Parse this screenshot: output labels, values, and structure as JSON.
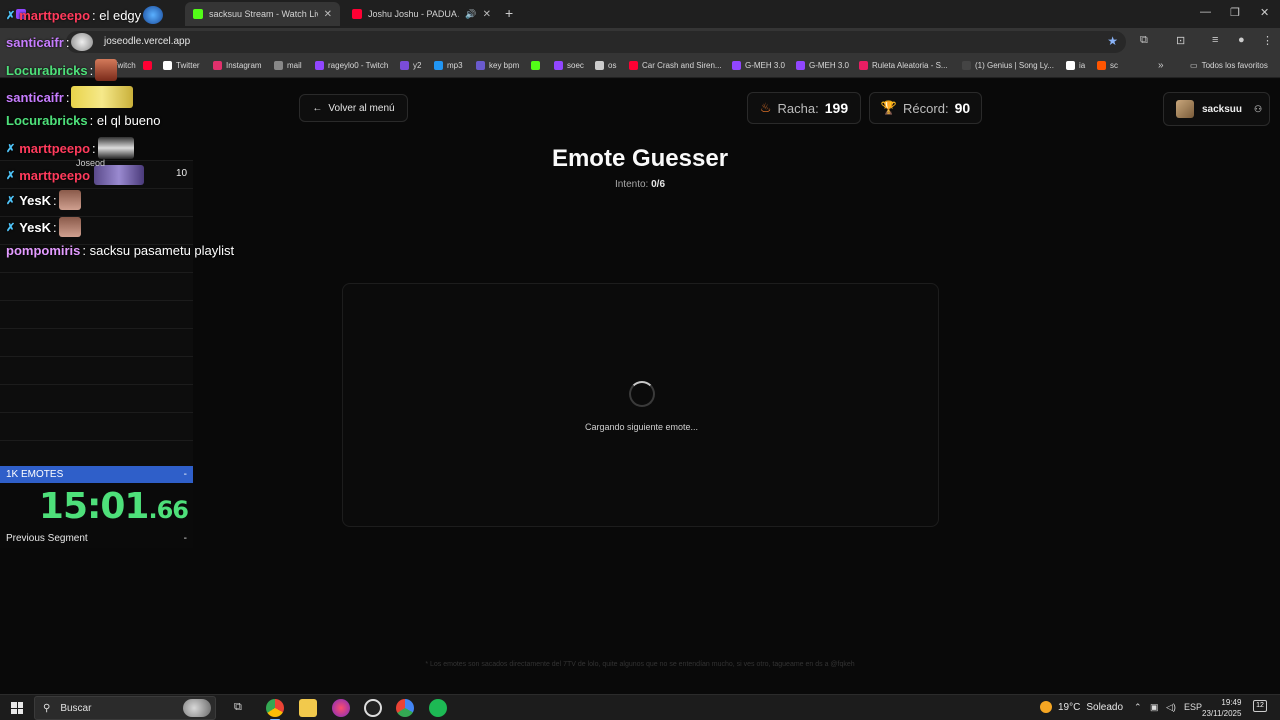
{
  "browser": {
    "tabs": [
      {
        "title": "",
        "color": "#9146ff"
      },
      {
        "title": "sacksuu Stream - Watch Live on",
        "color": "#53fc18"
      },
      {
        "title": "Joshu Joshu - PADUA ANGEL",
        "color": "#ff0033"
      }
    ],
    "new_tab": "+",
    "window_controls": {
      "minimize": "—",
      "maximize": "❐",
      "close": "✕"
    },
    "url": "joseodle.vercel.app",
    "bookmarks": [
      {
        "label": "Twitch",
        "color": "#9146ff"
      },
      {
        "label": "",
        "color": "#ff0033"
      },
      {
        "label": "Twitter",
        "color": "#ffffff"
      },
      {
        "label": "Instagram",
        "color": "#e1306c"
      },
      {
        "label": "mail",
        "color": "#888888"
      },
      {
        "label": "rageylo0 - Twitch",
        "color": "#9146ff"
      },
      {
        "label": "y2",
        "color": "#7a4cd9"
      },
      {
        "label": "mp3",
        "color": "#2196f3"
      },
      {
        "label": "key bpm",
        "color": "#6a5acd"
      },
      {
        "label": "",
        "color": "#53fc18"
      },
      {
        "label": "soec",
        "color": "#9146ff"
      },
      {
        "label": "os",
        "color": "#cccccc"
      },
      {
        "label": "Car Crash and Siren...",
        "color": "#ff0033"
      },
      {
        "label": "G-MEH 3.0",
        "color": "#9146ff"
      },
      {
        "label": "G-MEH 3.0",
        "color": "#9146ff"
      },
      {
        "label": "Ruleta Aleatoria - S...",
        "color": "#e91e63"
      },
      {
        "label": "(1) Genius | Song Ly...",
        "color": "#ffff64"
      },
      {
        "label": "ia",
        "color": "#ffffff"
      },
      {
        "label": "sc",
        "color": "#ff5500"
      }
    ],
    "all_bookmarks": "Todos los favoritos"
  },
  "page": {
    "back_button": "Volver al menú",
    "streak": {
      "label": "Racha:",
      "value": "199"
    },
    "record": {
      "label": "Récord:",
      "value": "90"
    },
    "username": "sacksuu",
    "title": "Emote Guesser",
    "attempt_label": "Intento:",
    "attempt_value": "0/6",
    "loading_text": "Cargando siguiente emote...",
    "footnote": "* Los emotes son sacados directamente del 7TV de lolo, quite algunos que no se entendían mucho, si ves otro, tagueame en ds a @fqkeh"
  },
  "chat": {
    "messages": [
      {
        "user": "marttpeepo",
        "text": ": el edgy",
        "color": "#ff3b5c",
        "badge": true
      },
      {
        "user": "santicaifr",
        "text": ":",
        "color": "#c77dff",
        "badge": false
      },
      {
        "user": "Locurabricks",
        "text": ":",
        "color": "#4ee07a",
        "badge": false
      },
      {
        "user": "santicaifr",
        "text": ":",
        "color": "#c77dff",
        "badge": false
      },
      {
        "user": "Locurabricks",
        "text": ": el ql bueno",
        "color": "#4ee07a",
        "badge": false
      },
      {
        "user": "marttpeepo",
        "text": ":",
        "color": "#ff3b5c",
        "badge": true
      },
      {
        "user": "marttpeepo",
        "text": "",
        "color": "#ff3b5c",
        "badge": true
      },
      {
        "user": "YesK",
        "text": ":",
        "color": "#ffffff",
        "badge": true
      },
      {
        "user": "YesK",
        "text": ":",
        "color": "#ffffff",
        "badge": true
      },
      {
        "user": "pompomiris",
        "text": ": sacksu pasametu playlist",
        "color": "#e39bff",
        "badge": false
      }
    ],
    "overlay_label": "Joseod",
    "overlay_number": "10"
  },
  "timer": {
    "split_name": "1K EMOTES",
    "split_delta": "-",
    "time_main": "15:01",
    "time_ms": ".66",
    "prev_label": "Previous Segment",
    "prev_value": "-"
  },
  "taskbar": {
    "search": "Buscar",
    "weather_temp": "19°C",
    "weather_desc": "Soleado",
    "lang": "ESP",
    "time": "19:49",
    "date": "23/11/2025",
    "notifications": "12"
  }
}
